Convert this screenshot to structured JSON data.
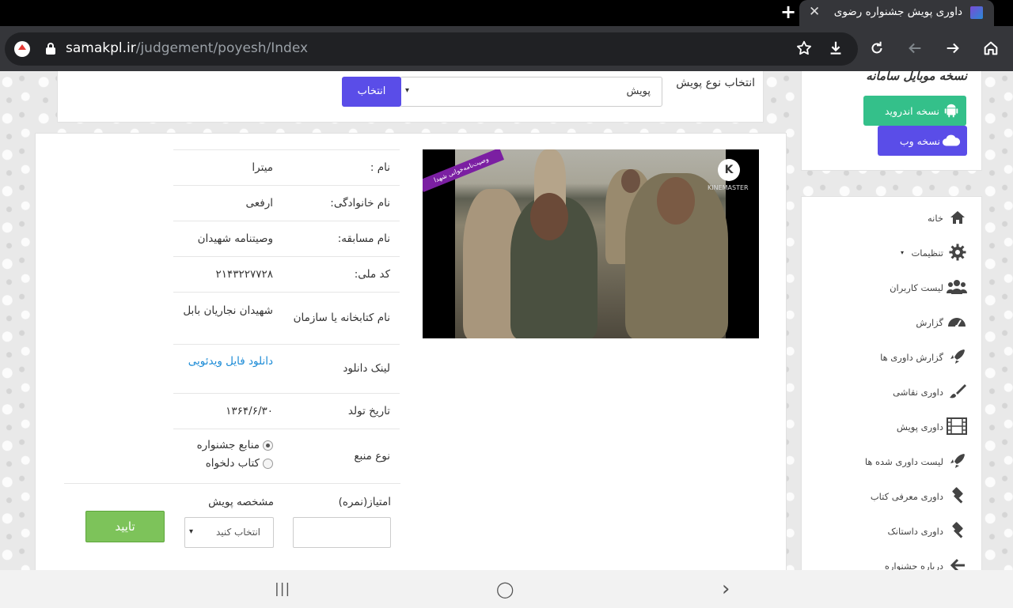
{
  "browser": {
    "tab_title": "داوری پویش جشنواره رضوی",
    "tab_close": "✕",
    "new_tab": "+",
    "url_host": "samakpl.ir",
    "url_path": "/judgement/poyesh/Index"
  },
  "filter": {
    "label": "انتخاب نوع پویش",
    "select_value": "پویش",
    "caret": "▾",
    "button": "انتخاب"
  },
  "video": {
    "ribbon_text": "وصیت‌نامه‌خوانی شهدا",
    "logo_letter": "K",
    "logo_text": "KINEMASTER"
  },
  "details": {
    "name_label": "نام :",
    "name_value": "میترا",
    "family_label": "نام خانوادگی:",
    "family_value": "ارفعی",
    "contest_label": "نام مسابقه:",
    "contest_value": "وصیتنامه شهیدان",
    "national_code_label": "کد ملی:",
    "national_code_value": "۲۱۴۳۲۲۷۷۲۸",
    "library_label": "نام کتابخانه یا سازمان",
    "library_value": "شهیدان نجاریان بابل",
    "download_label": "لینک دانلود",
    "download_link": "دانلود فایل ویدئویی",
    "birth_label": "تاریخ تولد",
    "birth_value": "۱۳۶۴/۶/۳۰",
    "source_label": "نوع منبع",
    "source_options": [
      "منابع جشنواره",
      "کتاب دلخواه"
    ],
    "source_selected": "منابع جشنواره"
  },
  "scoring": {
    "score_label": "امتیاز(نمره)",
    "score_value": "",
    "spec_label": "مشخصه پویش",
    "spec_placeholder": "انتخاب کنید",
    "spec_caret": "▾",
    "confirm_button": "تایید"
  },
  "mobile": {
    "title": "نسخه موبایل سامانه",
    "android_button": "نسخه اندروید",
    "web_button": "نسخه وب"
  },
  "menu": {
    "items": [
      {
        "label": "خانه",
        "icon": "home-icon"
      },
      {
        "label": "تنظیمات",
        "icon": "gear-icon",
        "dropdown": "▾"
      },
      {
        "label": "لیست کاربران",
        "icon": "users-icon"
      },
      {
        "label": "گزارش",
        "icon": "dashboard-icon"
      },
      {
        "label": "گزارش داوری ها",
        "icon": "rocket-icon"
      },
      {
        "label": "داوری نقاشی",
        "icon": "brush-icon"
      },
      {
        "label": "داوری پویش",
        "icon": "film-icon"
      },
      {
        "label": "لیست داوری شده ها",
        "icon": "rocket-icon"
      },
      {
        "label": "داوری معرفی کتاب",
        "icon": "gavel-icon"
      },
      {
        "label": "داوری داستانک",
        "icon": "gavel-icon"
      },
      {
        "label": "درباره جشنواره",
        "icon": "arrow-left-icon"
      }
    ]
  },
  "colors": {
    "accent": "#5a4de8",
    "android": "#34c08a",
    "confirm": "#7dc35a",
    "link": "#1a8ad6"
  },
  "navbar": {
    "recents": "|||",
    "home": "◯",
    "back": "›"
  }
}
